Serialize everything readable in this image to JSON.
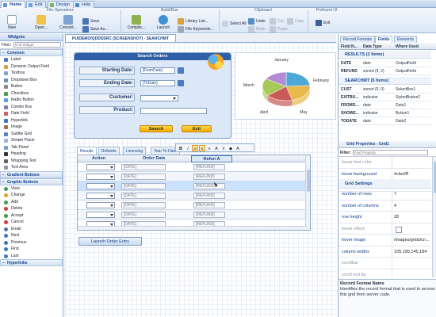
{
  "tabs": [
    {
      "label": "Home",
      "icon": "home-icon"
    },
    {
      "label": "Edit",
      "icon": "edit-icon"
    },
    {
      "label": "Design",
      "icon": "design-icon"
    },
    {
      "label": "Help",
      "icon": "help-icon"
    }
  ],
  "ribbon": {
    "groups": {
      "file": "File Operations",
      "build": "Build/Run",
      "clipboard": "Clipboard",
      "profound": "Profound UI"
    },
    "new": "New",
    "open": "Open...",
    "convert": "Convert...",
    "save": "Save",
    "save_as": "Save As...",
    "compile": "Compile...",
    "launch": "Launch",
    "library_list": "Library List...",
    "file_keywords": "File Keywords...",
    "select_all": "Select All",
    "undo": "Undo",
    "redo": "Redo",
    "cut": "Cut",
    "copy": "Copy",
    "paste": "Paste",
    "exit": "Exit"
  },
  "left": {
    "title": "Widgets",
    "filter_label": "Filter:",
    "filter_placeholder": "Find Widget",
    "common_title": "Common",
    "common": [
      "Label",
      "Dynamic Output Field",
      "Textbox",
      "Dropdown Box",
      "Button",
      "Checkbox",
      "Radio Button",
      "Combo Box",
      "Date Field",
      "Hyperlink",
      "Image",
      "Subfile Grid",
      "Simple Panel",
      "Tab Panel",
      "Heading",
      "Wrapping Text",
      "Text Area"
    ],
    "gradient_title": "Gradient Buttons",
    "graphic_title": "Graphic Buttons",
    "graphic": [
      "View",
      "Change",
      "Add",
      "Delete",
      "Accept",
      "Cancel",
      "Email",
      "Next",
      "Previous",
      "First",
      "Last"
    ],
    "hyperlinks_title": "Hyperlinks"
  },
  "doc_tab": "PUIDEMO/QDDSSRC (SCREENSHOT) - SEARCHMT",
  "search": {
    "title": "Search Orders",
    "starting_label": "Starting Date:",
    "starting_value": "[FromDate]",
    "ending_label": "Ending Date:",
    "ending_value": "[ToDate]",
    "customer_label": "Customer:",
    "product_label": "Product:",
    "search_btn": "Search",
    "exit_btn": "Exit"
  },
  "chart_data": {
    "type": "pie",
    "categories": [
      "January",
      "February",
      "March",
      "April",
      "May"
    ],
    "colors": [
      "#4da8d8",
      "#e8b94b",
      "#c95a5a",
      "#a8c95a",
      "#b48ad6"
    ]
  },
  "grid_tabs": [
    "Results",
    "Refunds",
    "Licensing",
    "Year To Date"
  ],
  "grid": {
    "headers": {
      "action": "Action",
      "date": "Order Date",
      "refund": "Refun A"
    },
    "rows": [
      {
        "date": "[DATE]",
        "refund": "[REFUND]"
      },
      {
        "date": "[DATE]",
        "refund": "[REFUND]"
      },
      {
        "date": "[DATE]",
        "refund": "[REFUND]"
      },
      {
        "date": "[DATE]",
        "refund": "[REFUND]"
      },
      {
        "date": "[DATE]",
        "refund": "[REFUND]"
      },
      {
        "date": "[DATE]",
        "refund": "[REFUND]"
      },
      {
        "date": "[DATE]",
        "refund": "[REFUND]"
      }
    ]
  },
  "launch_btn": "Launch Order Entry",
  "right": {
    "tabs": [
      "Record Formats",
      "Fields",
      "Elements"
    ],
    "headers": {
      "name": "Field N...",
      "type": "Data Type",
      "where": "Where Used"
    },
    "results_section": "RESULTS (2 Items)",
    "results": [
      {
        "name": "DATE",
        "type": "date",
        "where": "OutputField"
      },
      {
        "name": "REFUND",
        "type": "zoned (9, 2)",
        "where": "OutputField"
      }
    ],
    "searchmt_section": "SEARCHMT (5 Items)",
    "searchmt": [
      {
        "name": "CUST",
        "type": "zoned (9, 0)",
        "where": "SelectBox1"
      },
      {
        "name": "EXITBU...",
        "type": "indicator",
        "where": "StyledButton2"
      },
      {
        "name": "FROMD...",
        "type": "date",
        "where": "Date1"
      },
      {
        "name": "SHOWE...",
        "type": "indicator",
        "where": "Button1"
      },
      {
        "name": "TODATE",
        "type": "date",
        "where": "Date2"
      }
    ],
    "props_title": "Grid Properties - Grid1",
    "props_filter_label": "Filter:",
    "props_filter_placeholder": "Find Property",
    "props_top": [
      {
        "key": "hover font color",
        "value": "",
        "dim": true
      },
      {
        "key": "hover background",
        "value": "#cbe2ff",
        "dim": false
      },
      {
        "key": "hover border color",
        "value": "",
        "dim": true
      }
    ],
    "grid_settings": "Grid Settings",
    "props": [
      {
        "key": "number of rows",
        "value": "7",
        "dim": false
      },
      {
        "key": "number of columns",
        "value": "4",
        "dim": false
      },
      {
        "key": "row height",
        "value": "28",
        "dim": false
      },
      {
        "key": "hover effect",
        "value": "",
        "dim": true,
        "check": true
      },
      {
        "key": "hover image",
        "value": "/images/grids/cn...",
        "dim": false
      },
      {
        "key": "column widths",
        "value": "105,195,145,184",
        "dim": false
      },
      {
        "key": "scrollbar",
        "value": "",
        "dim": true
      },
      {
        "key": "scroll tool tip",
        "value": "",
        "dim": true
      }
    ],
    "help_title": "Record Format Name",
    "help_text": "Identifies the record format that is used to access this grid from server code."
  },
  "colors": {
    "accent": "#2f5fa6",
    "hover": "#cbe2ff",
    "button": "#f5a800"
  }
}
